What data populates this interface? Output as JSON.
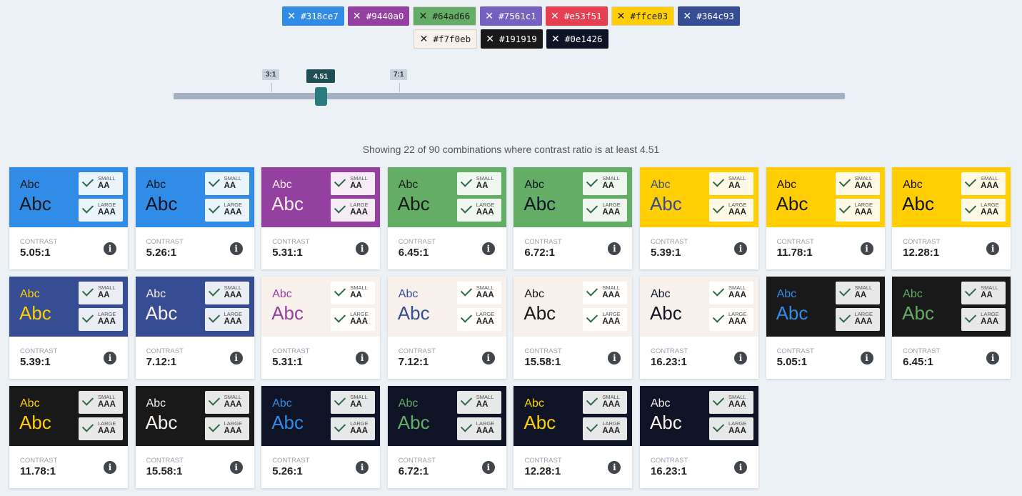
{
  "swatches": [
    {
      "hex": "#318ce7",
      "bg": "#318ce7",
      "style": "dark"
    },
    {
      "hex": "#9440a0",
      "bg": "#9440a0",
      "style": "dark"
    },
    {
      "hex": "#64ad66",
      "bg": "#64ad66",
      "style": "light"
    },
    {
      "hex": "#7561c1",
      "bg": "#7561c1",
      "style": "dark"
    },
    {
      "hex": "#e53f51",
      "bg": "#e53f51",
      "style": "dark"
    },
    {
      "hex": "#ffce03",
      "bg": "#ffce03",
      "style": "light"
    },
    {
      "hex": "#364c93",
      "bg": "#364c93",
      "style": "dark"
    },
    {
      "hex": "#f7f0eb",
      "bg": "#f7f0eb",
      "style": "light"
    },
    {
      "hex": "#191919",
      "bg": "#191919",
      "style": "dark"
    },
    {
      "hex": "#0e1426",
      "bg": "#0e1426",
      "style": "dark"
    }
  ],
  "remove_glyph": "✕",
  "slider": {
    "value_label": "4.51",
    "ticks": [
      "3:1",
      "7:1"
    ],
    "min": 1,
    "max": 21,
    "value": 4.51
  },
  "summary": "Showing 22 of 90 combinations where contrast ratio is at least 4.51",
  "labels": {
    "sample": "Abc",
    "small": "SMALL",
    "large": "LARGE",
    "contrast": "CONTRAST",
    "info_glyph": "i"
  },
  "cards": [
    {
      "bg": "#318ce7",
      "fg": "#191919",
      "small": "AA",
      "large": "AAA",
      "ratio": "5.05:1"
    },
    {
      "bg": "#318ce7",
      "fg": "#0e1426",
      "small": "AA",
      "large": "AAA",
      "ratio": "5.26:1"
    },
    {
      "bg": "#9440a0",
      "fg": "#f7f0eb",
      "small": "AA",
      "large": "AAA",
      "ratio": "5.31:1"
    },
    {
      "bg": "#64ad66",
      "fg": "#191919",
      "small": "AA",
      "large": "AAA",
      "ratio": "6.45:1"
    },
    {
      "bg": "#64ad66",
      "fg": "#0e1426",
      "small": "AA",
      "large": "AAA",
      "ratio": "6.72:1"
    },
    {
      "bg": "#ffce03",
      "fg": "#364c93",
      "small": "AA",
      "large": "AAA",
      "ratio": "5.39:1"
    },
    {
      "bg": "#ffce03",
      "fg": "#191919",
      "small": "AAA",
      "large": "AAA",
      "ratio": "11.78:1"
    },
    {
      "bg": "#ffce03",
      "fg": "#0e1426",
      "small": "AAA",
      "large": "AAA",
      "ratio": "12.28:1"
    },
    {
      "bg": "#364c93",
      "fg": "#ffce03",
      "small": "AA",
      "large": "AAA",
      "ratio": "5.39:1"
    },
    {
      "bg": "#364c93",
      "fg": "#f7f0eb",
      "small": "AAA",
      "large": "AAA",
      "ratio": "7.12:1"
    },
    {
      "bg": "#f7f0eb",
      "fg": "#9440a0",
      "small": "AA",
      "large": "AAA",
      "ratio": "5.31:1"
    },
    {
      "bg": "#f7f0eb",
      "fg": "#364c93",
      "small": "AAA",
      "large": "AAA",
      "ratio": "7.12:1"
    },
    {
      "bg": "#f7f0eb",
      "fg": "#191919",
      "small": "AAA",
      "large": "AAA",
      "ratio": "15.58:1"
    },
    {
      "bg": "#f7f0eb",
      "fg": "#0e1426",
      "small": "AAA",
      "large": "AAA",
      "ratio": "16.23:1"
    },
    {
      "bg": "#191919",
      "fg": "#318ce7",
      "small": "AA",
      "large": "AAA",
      "ratio": "5.05:1"
    },
    {
      "bg": "#191919",
      "fg": "#64ad66",
      "small": "AA",
      "large": "AAA",
      "ratio": "6.45:1"
    },
    {
      "bg": "#191919",
      "fg": "#ffce03",
      "small": "AAA",
      "large": "AAA",
      "ratio": "11.78:1"
    },
    {
      "bg": "#191919",
      "fg": "#f7f0eb",
      "small": "AAA",
      "large": "AAA",
      "ratio": "15.58:1"
    },
    {
      "bg": "#0e1426",
      "fg": "#318ce7",
      "small": "AA",
      "large": "AAA",
      "ratio": "5.26:1"
    },
    {
      "bg": "#0e1426",
      "fg": "#64ad66",
      "small": "AA",
      "large": "AAA",
      "ratio": "6.72:1"
    },
    {
      "bg": "#0e1426",
      "fg": "#ffce03",
      "small": "AAA",
      "large": "AAA",
      "ratio": "12.28:1"
    },
    {
      "bg": "#0e1426",
      "fg": "#f7f0eb",
      "small": "AAA",
      "large": "AAA",
      "ratio": "16.23:1"
    }
  ]
}
